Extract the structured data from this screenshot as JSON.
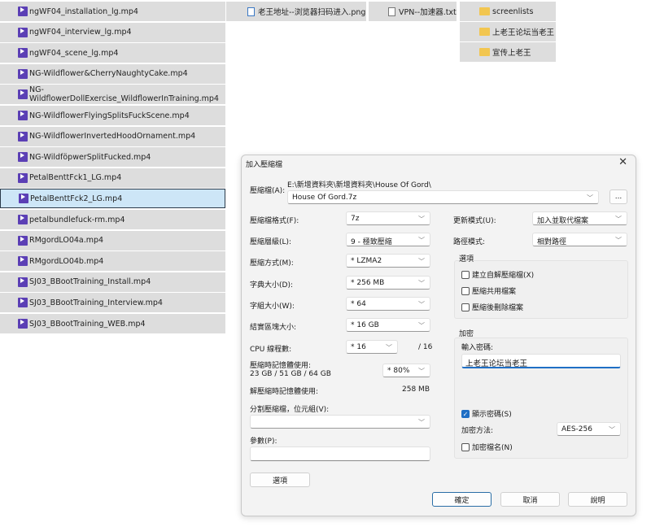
{
  "file_list": [
    {
      "name": "ngWF04_installation_lg.mp4",
      "selected": false
    },
    {
      "name": "ngWF04_interview_lg.mp4",
      "selected": false
    },
    {
      "name": "ngWF04_scene_lg.mp4",
      "selected": false
    },
    {
      "name": "NG-Wildflower&CherryNaughtyCake.mp4",
      "selected": false
    },
    {
      "name": "NG-WildflowerDollExercise_WildflowerInTraining.mp4",
      "selected": false
    },
    {
      "name": "NG-WildflowerFlyingSplitsFuckScene.mp4",
      "selected": false
    },
    {
      "name": "NG-WildflowerInvertedHoodOrnament.mp4",
      "selected": false
    },
    {
      "name": "NG-WildföpwerSplitFucked.mp4",
      "selected": false
    },
    {
      "name": "PetalBenttFck1_LG.mp4",
      "selected": false
    },
    {
      "name": "PetalBenttFck2_LG.mp4",
      "selected": true
    },
    {
      "name": "petalbundlefuck-rm.mp4",
      "selected": false
    },
    {
      "name": "RMgordLO04a.mp4",
      "selected": false
    },
    {
      "name": "RMgordLO04b.mp4",
      "selected": false
    },
    {
      "name": "SJ03_BBootTraining_Install.mp4",
      "selected": false
    },
    {
      "name": "SJ03_BBootTraining_Interview.mp4",
      "selected": false
    },
    {
      "name": "SJ03_BBootTraining_WEB.mp4",
      "selected": false
    }
  ],
  "other_files": {
    "png": "老王地址--浏览器扫码进入.png",
    "txt": "VPN--加速器.txt"
  },
  "folders": [
    "screenlists",
    "上老王论坛当老王",
    "宣传上老王"
  ],
  "dialog": {
    "title": "加入壓縮檔",
    "archive_label": "壓縮檔(A):",
    "archive_path": "E:\\新增資料夾\\新增資料夾\\House Of Gord\\",
    "archive_name": "House Of Gord.7z",
    "browse_label": "...",
    "format_label": "壓縮檔格式(F):",
    "format_value": "7z",
    "level_label": "壓縮層級(L):",
    "level_value": "9 - 極致壓縮",
    "method_label": "壓縮方式(M):",
    "method_value": "* LZMA2",
    "dict_label": "字典大小(D):",
    "dict_value": "* 256 MB",
    "word_label": "字組大小(W):",
    "word_value": "* 64",
    "solid_label": "結實區塊大小:",
    "solid_value": "* 16 GB",
    "cpu_label": "CPU 線程數:",
    "cpu_value": "* 16",
    "cpu_max": "/ 16",
    "mem_label": "壓縮時記憶體使用:",
    "mem_detail": "23 GB / 51 GB / 64 GB",
    "mem_value": "* 80%",
    "decomp_label": "解壓縮時記憶體使用:",
    "decomp_value": "258 MB",
    "split_label": "分割壓縮檔，位元組(V):",
    "split_value": "",
    "params_label": "參數(P):",
    "params_value": "",
    "options_button": "選項",
    "update_label": "更新模式(U):",
    "update_value": "加入並取代檔案",
    "path_label": "路徑模式:",
    "path_value": "相對路徑",
    "options_group": "選項",
    "options": [
      {
        "label": "建立自解壓縮檔(X)",
        "checked": false
      },
      {
        "label": "壓縮共用檔案",
        "checked": false
      },
      {
        "label": "壓縮後刪除檔案",
        "checked": false
      }
    ],
    "encrypt_group": "加密",
    "password_label": "輸入密碼:",
    "password_value": "上老王论坛当老王",
    "show_password": {
      "label": "顯示密碼(S)",
      "checked": true
    },
    "enc_method_label": "加密方法:",
    "enc_method_value": "AES-256",
    "encrypt_names": {
      "label": "加密檔名(N)",
      "checked": false
    },
    "ok": "確定",
    "cancel": "取消",
    "help": "說明"
  }
}
